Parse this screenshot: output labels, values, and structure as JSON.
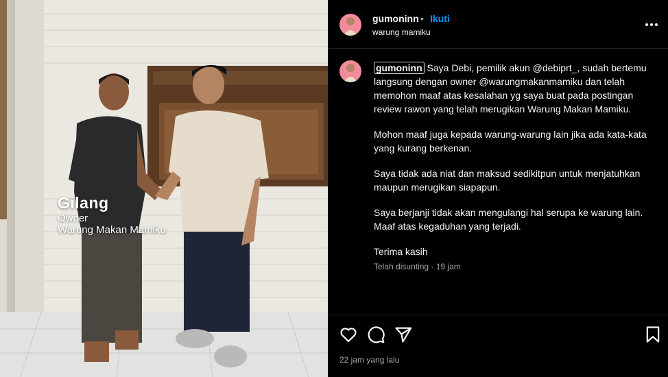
{
  "post": {
    "username": "gumoninn",
    "separator": "•",
    "follow_label": "Ikuti",
    "location": "warung mamiku",
    "time_ago": "22 jam yang lalu"
  },
  "photo": {
    "caption_name": "Gilang",
    "caption_role": "Owner",
    "caption_place": "Warung Makan Mamiku"
  },
  "caption": {
    "author": "gumoninn",
    "paragraphs": [
      "Saya Debi, pemilik akun @debiprt_, sudah bertemu langsung dengan owner @warungmakanmamiku dan telah memohon maaf atas kesalahan yg saya buat pada postingan review rawon yang telah merugikan Warung Makan Mamiku.",
      "Mohon maaf juga kepada warung-warung lain jika ada kata-kata yang kurang berkenan.",
      "Saya tidak ada niat dan maksud sedikitpun untuk menjatuhkan maupun merugikan siapapun.",
      "Saya berjanji tidak akan mengulangi hal serupa ke warung lain. Maaf atas kegaduhan yang terjadi.",
      "Terima kasih"
    ],
    "meta": "Telah disunting · 19 jam"
  },
  "colors": {
    "accent": "#0095f6",
    "avatar_bg": "#f28b9a",
    "secondary_text": "#a8a8a8"
  },
  "icons": {
    "like": "heart-icon",
    "comment": "comment-icon",
    "share": "paper-plane-icon",
    "save": "bookmark-icon",
    "more": "more-options-icon"
  }
}
